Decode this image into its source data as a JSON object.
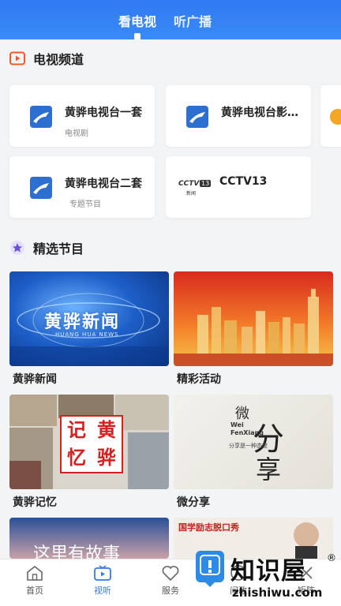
{
  "tabs": [
    {
      "label": "看电视",
      "active": true
    },
    {
      "label": "听广播",
      "active": false
    }
  ],
  "tv_section": {
    "title": "电视频道",
    "icon": "tv-icon"
  },
  "channels": [
    {
      "name": "黄骅电视台一套",
      "sub": "电视剧",
      "logo": "huanghua-logo"
    },
    {
      "name": "黄骅电视台影…",
      "sub": "",
      "logo": "huanghua-logo"
    },
    {
      "name": "黄骅电视台二套",
      "sub": "专题节目",
      "logo": "huanghua-logo"
    },
    {
      "name": "CCTV13",
      "sub": "",
      "logo": "cctv13-logo",
      "logo_text": "CCTV",
      "logo_num": "13",
      "logo_small": "新闻"
    }
  ],
  "featured_section": {
    "title": "精选节目",
    "icon": "star-icon"
  },
  "programs": [
    {
      "title": "黄骅新闻",
      "art_text": "黄骅新闻",
      "art_sub": "HUANG HUA NEWS"
    },
    {
      "title": "精彩活动"
    },
    {
      "title": "黄骅记忆",
      "art_chars": [
        "记",
        "黄",
        "忆",
        "骅"
      ]
    },
    {
      "title": "微分享",
      "art_main": "分",
      "art_top": "微",
      "art_bottom": "享",
      "art_en1": "Wei",
      "art_en2": "FenXiang",
      "art_line": "分享是一种态度"
    },
    {
      "title": "",
      "art_text": "这里有故事"
    },
    {
      "title": "",
      "art_text": "国学励志脱口秀"
    }
  ],
  "bottom_nav": [
    {
      "label": "首页",
      "icon": "home-icon",
      "active": false
    },
    {
      "label": "视听",
      "icon": "tv-play-icon",
      "active": true
    },
    {
      "label": "服务",
      "icon": "heart-icon",
      "active": false
    },
    {
      "label": "问政",
      "icon": "question-icon",
      "active": false
    },
    {
      "label": "矩阵",
      "icon": "matrix-icon",
      "active": false
    }
  ],
  "watermark": {
    "brand": "知识屋",
    "url": "zhishiwu.com",
    "mark": "®"
  },
  "colors": {
    "primary": "#2f7bf2",
    "accent_orange": "#f05a28",
    "active_nav": "#2f7bf2"
  }
}
